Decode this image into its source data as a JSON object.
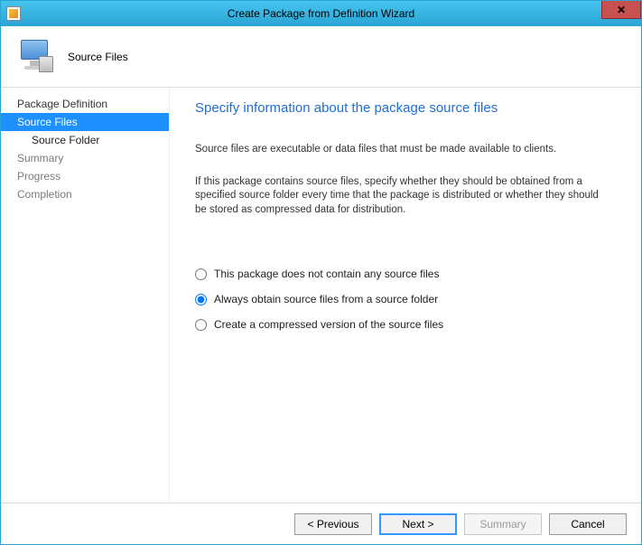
{
  "window": {
    "title": "Create Package from Definition Wizard"
  },
  "header": {
    "title": "Source Files"
  },
  "sidebar": {
    "items": [
      {
        "label": "Package Definition",
        "selected": false,
        "sub": false,
        "muted": false
      },
      {
        "label": "Source Files",
        "selected": true,
        "sub": false,
        "muted": false
      },
      {
        "label": "Source Folder",
        "selected": false,
        "sub": true,
        "muted": false
      },
      {
        "label": "Summary",
        "selected": false,
        "sub": false,
        "muted": true
      },
      {
        "label": "Progress",
        "selected": false,
        "sub": false,
        "muted": true
      },
      {
        "label": "Completion",
        "selected": false,
        "sub": false,
        "muted": true
      }
    ]
  },
  "content": {
    "heading": "Specify information about the package source files",
    "para1": "Source files are executable or data files that must be made available to clients.",
    "para2": "If this package contains source files, specify whether they should be obtained from a specified source folder every time that the package is distributed or whether they should be stored as compressed data for distribution.",
    "options": [
      {
        "label": "This package does not contain any source files",
        "checked": false
      },
      {
        "label": "Always obtain source files from a source folder",
        "checked": true
      },
      {
        "label": "Create a compressed version of the source files",
        "checked": false
      }
    ]
  },
  "footer": {
    "previous": "< Previous",
    "next": "Next >",
    "summary": "Summary",
    "cancel": "Cancel",
    "summary_enabled": false
  }
}
